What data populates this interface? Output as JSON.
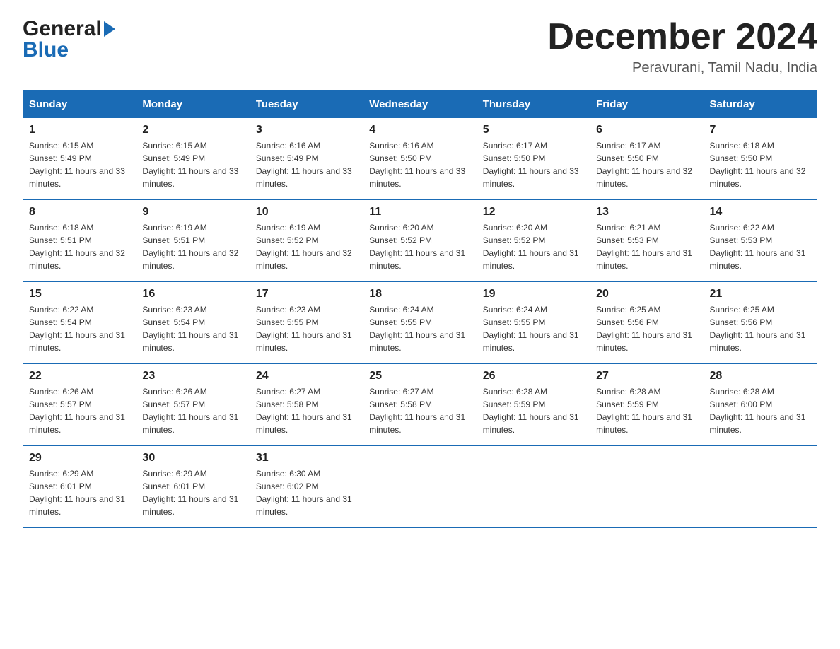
{
  "header": {
    "logo_general": "General",
    "logo_blue": "Blue",
    "month_title": "December 2024",
    "location": "Peravurani, Tamil Nadu, India"
  },
  "days_of_week": [
    "Sunday",
    "Monday",
    "Tuesday",
    "Wednesday",
    "Thursday",
    "Friday",
    "Saturday"
  ],
  "weeks": [
    [
      {
        "date": "1",
        "sunrise": "6:15 AM",
        "sunset": "5:49 PM",
        "daylight": "11 hours and 33 minutes."
      },
      {
        "date": "2",
        "sunrise": "6:15 AM",
        "sunset": "5:49 PM",
        "daylight": "11 hours and 33 minutes."
      },
      {
        "date": "3",
        "sunrise": "6:16 AM",
        "sunset": "5:49 PM",
        "daylight": "11 hours and 33 minutes."
      },
      {
        "date": "4",
        "sunrise": "6:16 AM",
        "sunset": "5:50 PM",
        "daylight": "11 hours and 33 minutes."
      },
      {
        "date": "5",
        "sunrise": "6:17 AM",
        "sunset": "5:50 PM",
        "daylight": "11 hours and 33 minutes."
      },
      {
        "date": "6",
        "sunrise": "6:17 AM",
        "sunset": "5:50 PM",
        "daylight": "11 hours and 32 minutes."
      },
      {
        "date": "7",
        "sunrise": "6:18 AM",
        "sunset": "5:50 PM",
        "daylight": "11 hours and 32 minutes."
      }
    ],
    [
      {
        "date": "8",
        "sunrise": "6:18 AM",
        "sunset": "5:51 PM",
        "daylight": "11 hours and 32 minutes."
      },
      {
        "date": "9",
        "sunrise": "6:19 AM",
        "sunset": "5:51 PM",
        "daylight": "11 hours and 32 minutes."
      },
      {
        "date": "10",
        "sunrise": "6:19 AM",
        "sunset": "5:52 PM",
        "daylight": "11 hours and 32 minutes."
      },
      {
        "date": "11",
        "sunrise": "6:20 AM",
        "sunset": "5:52 PM",
        "daylight": "11 hours and 31 minutes."
      },
      {
        "date": "12",
        "sunrise": "6:20 AM",
        "sunset": "5:52 PM",
        "daylight": "11 hours and 31 minutes."
      },
      {
        "date": "13",
        "sunrise": "6:21 AM",
        "sunset": "5:53 PM",
        "daylight": "11 hours and 31 minutes."
      },
      {
        "date": "14",
        "sunrise": "6:22 AM",
        "sunset": "5:53 PM",
        "daylight": "11 hours and 31 minutes."
      }
    ],
    [
      {
        "date": "15",
        "sunrise": "6:22 AM",
        "sunset": "5:54 PM",
        "daylight": "11 hours and 31 minutes."
      },
      {
        "date": "16",
        "sunrise": "6:23 AM",
        "sunset": "5:54 PM",
        "daylight": "11 hours and 31 minutes."
      },
      {
        "date": "17",
        "sunrise": "6:23 AM",
        "sunset": "5:55 PM",
        "daylight": "11 hours and 31 minutes."
      },
      {
        "date": "18",
        "sunrise": "6:24 AM",
        "sunset": "5:55 PM",
        "daylight": "11 hours and 31 minutes."
      },
      {
        "date": "19",
        "sunrise": "6:24 AM",
        "sunset": "5:55 PM",
        "daylight": "11 hours and 31 minutes."
      },
      {
        "date": "20",
        "sunrise": "6:25 AM",
        "sunset": "5:56 PM",
        "daylight": "11 hours and 31 minutes."
      },
      {
        "date": "21",
        "sunrise": "6:25 AM",
        "sunset": "5:56 PM",
        "daylight": "11 hours and 31 minutes."
      }
    ],
    [
      {
        "date": "22",
        "sunrise": "6:26 AM",
        "sunset": "5:57 PM",
        "daylight": "11 hours and 31 minutes."
      },
      {
        "date": "23",
        "sunrise": "6:26 AM",
        "sunset": "5:57 PM",
        "daylight": "11 hours and 31 minutes."
      },
      {
        "date": "24",
        "sunrise": "6:27 AM",
        "sunset": "5:58 PM",
        "daylight": "11 hours and 31 minutes."
      },
      {
        "date": "25",
        "sunrise": "6:27 AM",
        "sunset": "5:58 PM",
        "daylight": "11 hours and 31 minutes."
      },
      {
        "date": "26",
        "sunrise": "6:28 AM",
        "sunset": "5:59 PM",
        "daylight": "11 hours and 31 minutes."
      },
      {
        "date": "27",
        "sunrise": "6:28 AM",
        "sunset": "5:59 PM",
        "daylight": "11 hours and 31 minutes."
      },
      {
        "date": "28",
        "sunrise": "6:28 AM",
        "sunset": "6:00 PM",
        "daylight": "11 hours and 31 minutes."
      }
    ],
    [
      {
        "date": "29",
        "sunrise": "6:29 AM",
        "sunset": "6:01 PM",
        "daylight": "11 hours and 31 minutes."
      },
      {
        "date": "30",
        "sunrise": "6:29 AM",
        "sunset": "6:01 PM",
        "daylight": "11 hours and 31 minutes."
      },
      {
        "date": "31",
        "sunrise": "6:30 AM",
        "sunset": "6:02 PM",
        "daylight": "11 hours and 31 minutes."
      },
      null,
      null,
      null,
      null
    ]
  ],
  "labels": {
    "sunrise": "Sunrise:",
    "sunset": "Sunset:",
    "daylight": "Daylight:"
  }
}
